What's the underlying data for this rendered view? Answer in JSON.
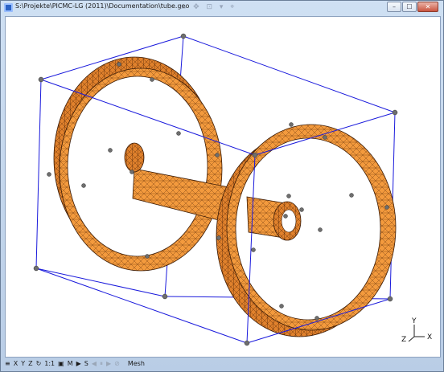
{
  "window": {
    "title": "S:\\Projekte\\PICMC-LG (2011)\\Documentation\\tube.geo",
    "minimize_label": "–",
    "maximize_label": "☐",
    "close_label": "✕"
  },
  "title_overlay_icons": "◌ ▭ ✥ ⊡ ▾ ⌖",
  "axes": {
    "y": "Y",
    "z": "Z",
    "x": "X"
  },
  "statusbar": {
    "menu": "≡",
    "x": "X",
    "y": "Y",
    "z": "Z",
    "rotate": "↻",
    "scale": "1:1",
    "snapshot": "▣",
    "m": "M",
    "play": "▶",
    "s": "S",
    "prev": "◀",
    "pause": "⏸",
    "next": "▶",
    "stop": "⊘",
    "status_text": "Mesh"
  },
  "colors": {
    "mesh_fill": "#f39a3d",
    "mesh_dark": "#c8671a",
    "mesh_line": "#5a2a08",
    "box_line": "#1a1adc",
    "node": "#6e6e6e"
  }
}
